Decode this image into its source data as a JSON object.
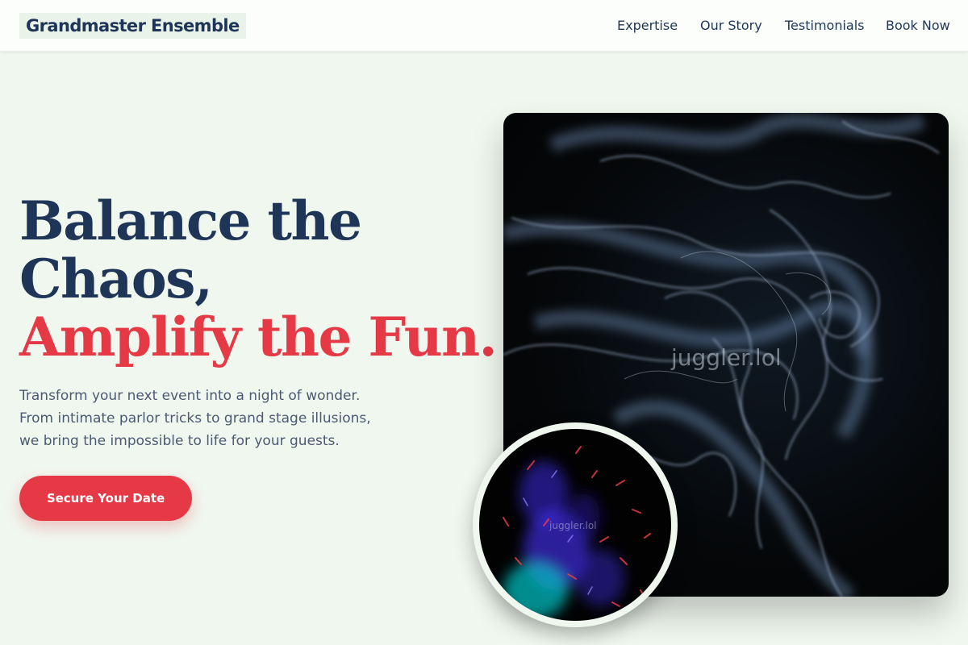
{
  "header": {
    "brand": "Grandmaster Ensemble",
    "nav": [
      "Expertise",
      "Our Story",
      "Testimonials",
      "Book Now"
    ]
  },
  "hero": {
    "title_line1": "Balance the",
    "title_line2": "Chaos,",
    "title_line3": "Amplify the Fun.",
    "subtitle_line1": "Transform your next event into a night of wonder.",
    "subtitle_line2": "From intimate parlor tricks to grand stage illusions,",
    "subtitle_line3": "we bring the impossible to life for your guests.",
    "cta_label": "Secure Your Date"
  },
  "images": {
    "main_watermark": "juggler.lol",
    "circle_watermark": "juggler.lol"
  },
  "colors": {
    "background": "#f0f7ef",
    "navy": "#1f3557",
    "accent": "#e63946",
    "body_text": "#4a5a72"
  }
}
